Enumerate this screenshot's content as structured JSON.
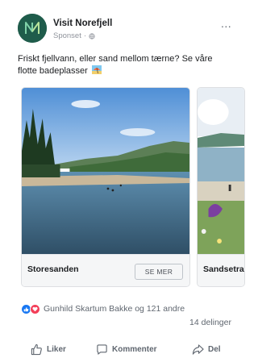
{
  "post": {
    "page_name": "Visit Norefjell",
    "sponsored_label": "Sponset",
    "separator": "·",
    "more_label": "...",
    "text": "Friskt fjellvann, eller sand mellom tærne? Se våre flotte badeplasser",
    "avatar_icon": "norefjell-logo-icon"
  },
  "carousel": {
    "cards": [
      {
        "title": "Storesanden",
        "cta_label": "SE MER",
        "image": "lake-shore-photo"
      },
      {
        "title": "Sandsetra",
        "image": "beach-people-photo"
      }
    ]
  },
  "engagement": {
    "reaction_icons": [
      "like-icon",
      "love-icon"
    ],
    "reactions_text": "Gunhild Skartum Bakke og 121 andre",
    "shares_text": "14 delinger"
  },
  "actions": {
    "like_label": "Liker",
    "comment_label": "Kommenter",
    "share_label": "Del"
  },
  "colors": {
    "brand_green": "#1f5c4b",
    "like_blue": "#1877f2",
    "love_red": "#f33e58",
    "text_secondary": "#606770"
  }
}
